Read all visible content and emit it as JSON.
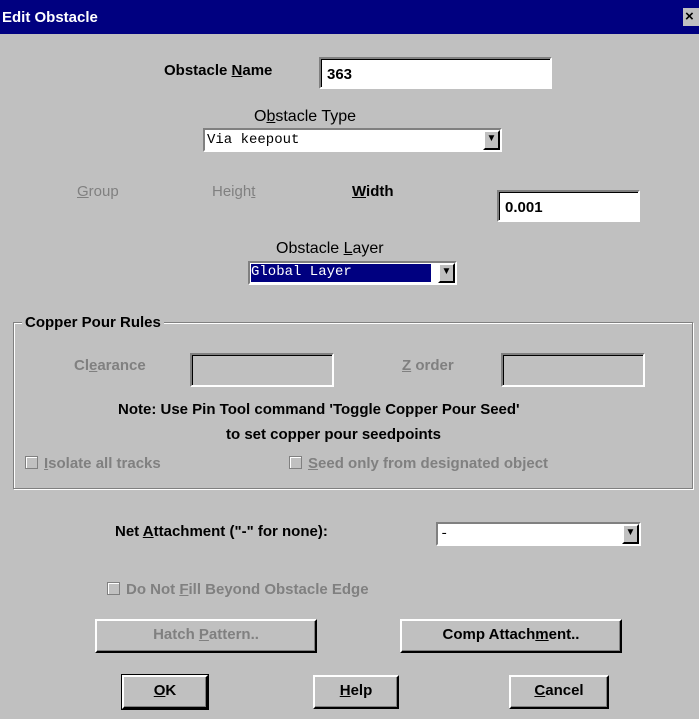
{
  "window": {
    "title": "Edit Obstacle",
    "close_glyph": "×"
  },
  "obstacle_name": {
    "label_pre": "Obstacle ",
    "label_key": "N",
    "label_post": "ame",
    "value": "363"
  },
  "obstacle_type": {
    "label_pre": "O",
    "label_key": "b",
    "label_post": "stacle Type",
    "value": "Via keepout"
  },
  "dimensions": {
    "group": {
      "label_key": "G",
      "label_post": "roup"
    },
    "height": {
      "label_pre": "Heigh",
      "label_key": "t"
    },
    "width": {
      "label_key": "W",
      "label_post": "idth",
      "value": "0.001"
    }
  },
  "obstacle_layer": {
    "label_pre": "Obstacle ",
    "label_key": "L",
    "label_post": "ayer",
    "value": "Global Layer"
  },
  "copper_pour": {
    "title": "Copper Pour Rules",
    "clearance": {
      "label_pre": "Cl",
      "label_key": "e",
      "label_post": "arance",
      "value": ""
    },
    "zorder": {
      "label_key": "Z",
      "label_post": " order",
      "value": ""
    },
    "note_line1": "Note: Use Pin Tool command 'Toggle Copper Pour Seed'",
    "note_line2": "to set copper pour seedpoints",
    "isolate": {
      "label_key": "I",
      "label_post": "solate all tracks"
    },
    "seed": {
      "label_key": "S",
      "label_post": "eed only from designated object"
    }
  },
  "net_attachment": {
    "label_pre": "Net ",
    "label_key": "A",
    "label_post": "ttachment (\"-\" for none):",
    "value": "-"
  },
  "do_not_fill": {
    "label_pre": "Do Not ",
    "label_key": "F",
    "label_post": "ill Beyond Obstacle Edge"
  },
  "buttons": {
    "hatch": {
      "pre": "Hatch ",
      "key": "P",
      "post": "attern.."
    },
    "comp": {
      "pre": "Comp Attach",
      "key": "m",
      "post": "ent.."
    },
    "ok": {
      "pre": "",
      "key": "O",
      "post": "K"
    },
    "help": {
      "pre": "",
      "key": "H",
      "post": "elp"
    },
    "cancel": {
      "pre": "",
      "key": "C",
      "post": "ancel"
    }
  },
  "icons": {
    "dropdown": "triangle-down",
    "checkbox": "empty-box"
  }
}
